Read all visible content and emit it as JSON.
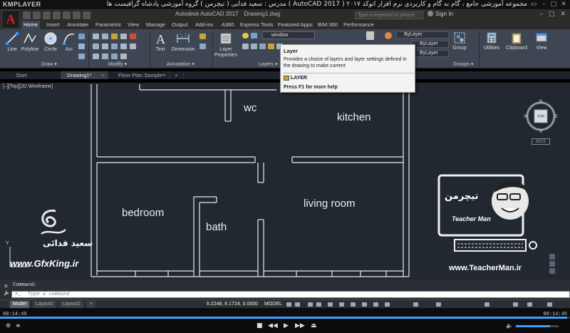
{
  "kmplayer": {
    "logo": "KMPLAYER",
    "caption": "مجموعه آموزشی جامع ، گام به گام و کاربردی نرم افزار   اتوکد ۲۰۱۷ ( AutoCAD 2017 )   مدرس : سعید فدایی ( تیچرمن ) گروه آموزشی پادشاه گرافیست ها",
    "win_buttons": [
      "▭",
      "–",
      "□",
      "✕"
    ],
    "time_elapsed": "00:14:45",
    "time_total": "00:14:45",
    "progress": 0.995,
    "volume": 0.8,
    "controls": [
      "■",
      "◀◀",
      "▶",
      "▶▶",
      "⏏"
    ]
  },
  "autocad": {
    "app_button": "A",
    "title": "Autodesk AutoCAD 2017",
    "filename": "Drawing1.dwg",
    "search_placeholder": "Type a keyword or phrase",
    "sign_in": "Sign In",
    "win_buttons": [
      "–",
      "□",
      "✕"
    ]
  },
  "ribbon": {
    "tabs": [
      "Home",
      "Insert",
      "Annotate",
      "Parametric",
      "View",
      "Manage",
      "Output",
      "Add-ins",
      "A360",
      "Express Tools",
      "Featured Apps",
      "BIM 360",
      "Performance"
    ],
    "active_tab": "Home",
    "draw_tools": [
      "Line",
      "Polyline",
      "Circle",
      "Arc"
    ],
    "annotation_tools": [
      "Text",
      "Dimension"
    ],
    "layer_properties": "Layer Properties",
    "layer_combo": "window",
    "bylayer_labels": [
      "ByLayer",
      "ByLayer",
      "ByLayer"
    ],
    "right_tools": [
      "Group",
      "Utilities",
      "Clipboard",
      "View"
    ],
    "panels": [
      "Draw ▾",
      "Modify ▾",
      "Annotation ▾",
      "Layers ▾",
      "Groups ▾"
    ]
  },
  "tooltip": {
    "title": "Layer",
    "description": "Provides a choice of layers and layer settings defined in the drawing to make current",
    "command": "LAYER",
    "help": "Press F1 for more help"
  },
  "file_tabs": [
    {
      "label": "Start",
      "close": ""
    },
    {
      "label": "Drawing1*",
      "close": "×"
    },
    {
      "label": "Floor Plan Sample*",
      "close": "×"
    },
    {
      "label": "+",
      "close": ""
    }
  ],
  "viewport": {
    "label": "[–][Top][2D Wireframe]",
    "rooms": {
      "wc": "wc",
      "kitchen": "kitchen",
      "bedroom": "bedroom",
      "bath": "bath",
      "living": "living room"
    },
    "viewcube": {
      "top": "TOP",
      "n": "N",
      "s": "S",
      "e": "E",
      "w": "W"
    },
    "wcs": "WCS",
    "ucs_y": "Y"
  },
  "branding": {
    "gfxking_url": "www.GfxKing.ir",
    "gfxking_name": "سعید فدائی",
    "teacherman_url": "www.TeacherMan.ir",
    "teacherman_caption": "Teacher Man",
    "teacherman_logo": "تیچرمن"
  },
  "command_line": {
    "history": "Command:",
    "placeholder": "Type a command",
    "close": "✕"
  },
  "status_bar": {
    "layout_tabs": [
      "Model",
      "Layout1",
      "Layout2",
      "+"
    ],
    "active_layout": "Model",
    "coordinates": "6.2248, 6.1724, 0.0000",
    "model": "MODEL"
  }
}
